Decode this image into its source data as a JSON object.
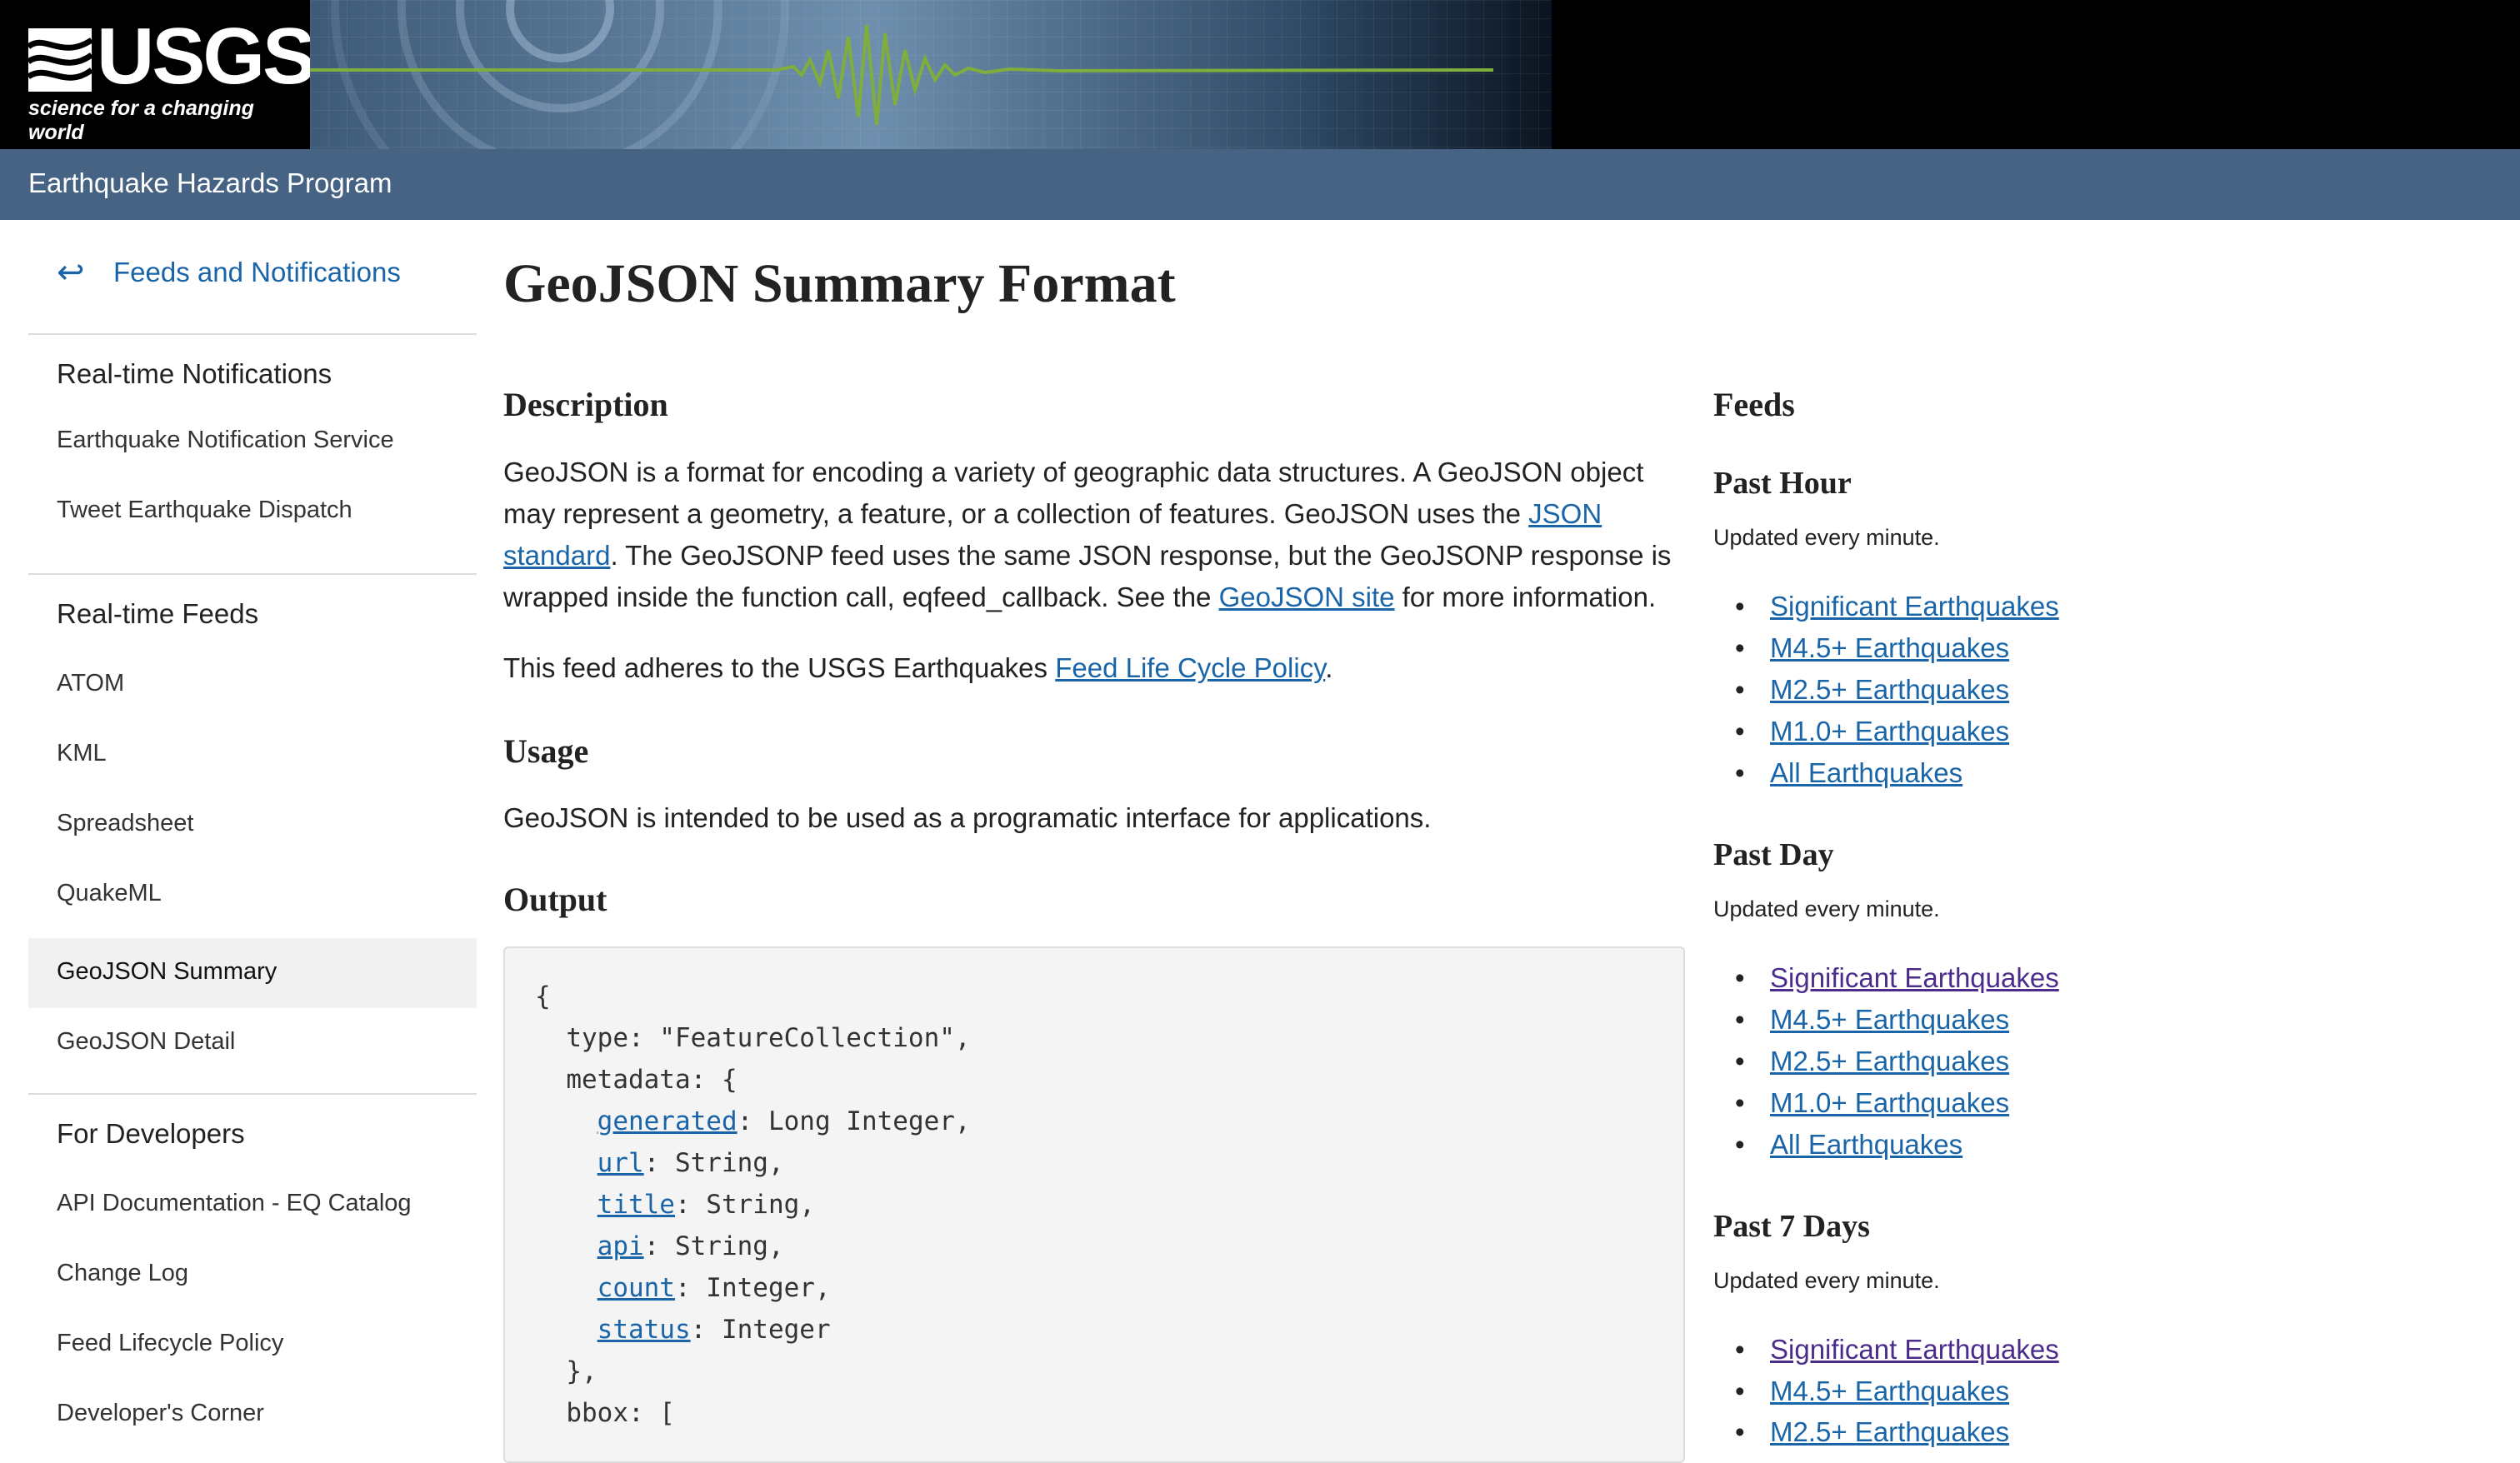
{
  "header": {
    "logo_text": "USGS",
    "logo_tagline": "science for a changing world",
    "program": "Earthquake Hazards Program"
  },
  "sidebar": {
    "back_label": "Feeds and Notifications",
    "back_icon": "arrow-return-icon",
    "sections": [
      {
        "title": "Real-time Notifications",
        "items": [
          {
            "label": "Earthquake Notification Service"
          },
          {
            "label": "Tweet Earthquake Dispatch"
          }
        ]
      },
      {
        "title": "Real-time Feeds",
        "items": [
          {
            "label": "ATOM"
          },
          {
            "label": "KML"
          },
          {
            "label": "Spreadsheet"
          },
          {
            "label": "QuakeML"
          },
          {
            "label": "GeoJSON Summary",
            "active": true
          },
          {
            "label": "GeoJSON Detail"
          }
        ]
      },
      {
        "title": "For Developers",
        "items": [
          {
            "label": "API Documentation - EQ Catalog"
          },
          {
            "label": "Change Log"
          },
          {
            "label": "Feed Lifecycle Policy"
          },
          {
            "label": "Developer's Corner"
          }
        ]
      }
    ]
  },
  "main": {
    "title": "GeoJSON Summary Format",
    "description_heading": "Description",
    "description": {
      "part1": "GeoJSON is a format for encoding a variety of geographic data structures. A GeoJSON object may represent a geometry, a feature, or a collection of features. GeoJSON uses the ",
      "link1": "JSON standard",
      "part2": ". The GeoJSONP feed uses the same JSON response, but the GeoJSONP response is wrapped inside the function call, eqfeed_callback. See the ",
      "link2": "GeoJSON site",
      "part3": " for more information."
    },
    "policy": {
      "part1": "This feed adheres to the USGS Earthquakes ",
      "link": "Feed Life Cycle Policy",
      "part2": "."
    },
    "usage_heading": "Usage",
    "usage_text": "GeoJSON is intended to be used as a programatic interface for applications.",
    "output_heading": "Output",
    "code": {
      "l1": "{",
      "l2": "  type: \"FeatureCollection\",",
      "l3": "  metadata: {",
      "fields": [
        {
          "name": "generated",
          "type": ": Long Integer,"
        },
        {
          "name": "url",
          "type": ": String,"
        },
        {
          "name": "title",
          "type": ": String,"
        },
        {
          "name": "api",
          "type": ": String,"
        },
        {
          "name": "count",
          "type": ": Integer,"
        },
        {
          "name": "status",
          "type": ": Integer"
        }
      ],
      "l10": "  },",
      "l11": "  bbox: ["
    }
  },
  "feeds": {
    "title": "Feeds",
    "groups": [
      {
        "title": "Past Hour",
        "updated": "Updated every minute.",
        "links": [
          "Significant Earthquakes",
          "M4.5+ Earthquakes",
          "M2.5+ Earthquakes",
          "M1.0+ Earthquakes",
          "All Earthquakes"
        ]
      },
      {
        "title": "Past Day",
        "updated": "Updated every minute.",
        "links": [
          "Significant Earthquakes",
          "M4.5+ Earthquakes",
          "M2.5+ Earthquakes",
          "M1.0+ Earthquakes",
          "All Earthquakes"
        ]
      },
      {
        "title": "Past 7 Days",
        "updated": "Updated every minute.",
        "links": [
          "Significant Earthquakes",
          "M4.5+ Earthquakes",
          "M2.5+ Earthquakes"
        ]
      }
    ]
  },
  "colors": {
    "program_bar": "#466383",
    "link": "#1a64a8",
    "visited_link": "#4b2c8a",
    "seismogram": "#7fae3c"
  }
}
